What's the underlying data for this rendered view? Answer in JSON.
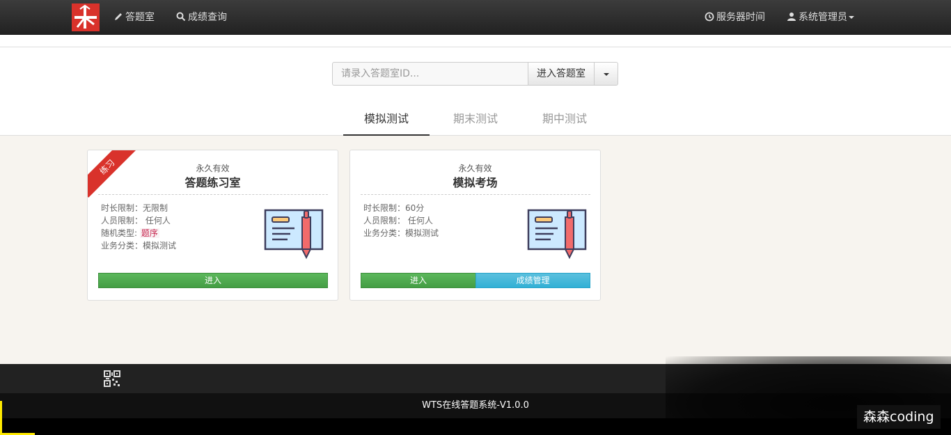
{
  "nav": {
    "left": [
      {
        "icon": "pencil-icon",
        "label": "答题室"
      },
      {
        "icon": "search-icon",
        "label": "成绩查询"
      }
    ],
    "right": [
      {
        "icon": "clock-icon",
        "label": "服务器时间"
      },
      {
        "icon": "user-icon",
        "label": "系统管理员"
      }
    ]
  },
  "search": {
    "placeholder": "请录入答题室ID...",
    "button_label": "进入答题室"
  },
  "tabs": [
    {
      "label": "模拟测试",
      "active": true
    },
    {
      "label": "期末测试",
      "active": false
    },
    {
      "label": "期中测试",
      "active": false
    }
  ],
  "cards": [
    {
      "ribbon": "练习",
      "validity": "永久有效",
      "title": "答题练习室",
      "time_limit": "时长限制：无限制",
      "people_limit": "人员限制： 任何人",
      "random_type_label": "随机类型: ",
      "random_type_value": "题序",
      "category": "业务分类：模拟测试",
      "enter_label": "进入"
    },
    {
      "validity": "永久有效",
      "title": "模拟考场",
      "time_limit": "时长限制：60分",
      "people_limit": "人员限制： 任何人",
      "category": "业务分类：模拟测试",
      "enter_label": "进入",
      "score_label": "成绩管理"
    }
  ],
  "footer": {
    "copyright": "WTS在线答题系统-V1.0.0"
  },
  "watermark": "森森coding",
  "colors": {
    "brand": "#d9322b",
    "enter_green": "#5cb85c",
    "score_blue": "#5bc0de",
    "content_bg": "#f7f4ef"
  }
}
